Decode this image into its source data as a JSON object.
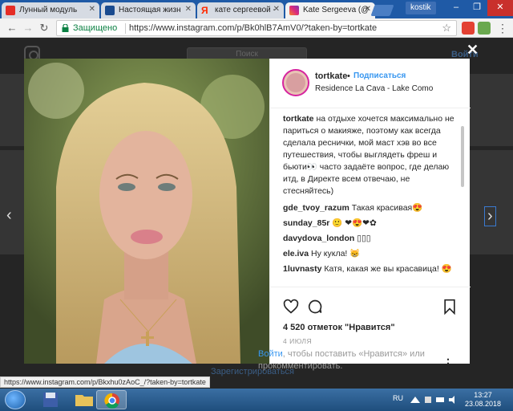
{
  "browser": {
    "tabs": [
      {
        "label": "Лунный модуль",
        "favicon_color": "#e52d27",
        "active": false
      },
      {
        "label": "Настоящая жизн",
        "favicon_color": "#1a4b8f",
        "active": false
      },
      {
        "label": "кате сергеевой -",
        "favicon_color": "#ff2a00",
        "active": false
      },
      {
        "label": "Kate Sergeeva (@",
        "favicon_color": "#c13584",
        "active": true
      }
    ],
    "profile_name": "kostik",
    "secure_label": "Защищено",
    "url": "https://www.instagram.com/p/Bk0hlB7AmV0/?taken-by=tortkate",
    "status_url": "https://www.instagram.com/p/Bkxhu0zAoC_/?taken-by=tortkate"
  },
  "background_page": {
    "search_placeholder": "Поиск",
    "login_link": "Войти",
    "register_link": "Зарегистрироваться"
  },
  "post": {
    "username": "tortkate",
    "separator": "•",
    "follow_label": "Подписаться",
    "location": "Residence La Cava - Lake Como",
    "caption_user": "tortkate",
    "caption_text": "на отдыхе хочется максимально не париться о макияже, поэтому как всегда сделала реснички, мой маст хэв во все путешествия, чтобы выглядеть фреш и бьюти👀 часто задаёте вопрос, где делаю итд, в Директе всем отвечаю, не стесняйтесь)",
    "comments": [
      {
        "user": "gde_tvoy_razum",
        "text": "Такая красивая😍"
      },
      {
        "user": "sunday_85r",
        "text": "🙂 ❤😍❤✿"
      },
      {
        "user": "davydova_london",
        "text": "▯▯▯"
      },
      {
        "user": "ele.iva",
        "text": "Ну кукла! 😸"
      },
      {
        "user": "1luvnasty",
        "text": "Катя, какая же вы красавица! 😍"
      }
    ],
    "likes": "4 520 отметок \"Нравится\"",
    "date": "4 ИЮЛЯ",
    "login_link": "Войти",
    "login_prompt": ", чтобы поставить «Нравится» или прокомментировать.",
    "more_label": "⋮"
  },
  "taskbar": {
    "language": "RU",
    "time": "13:27",
    "date": "23.08.2018"
  }
}
